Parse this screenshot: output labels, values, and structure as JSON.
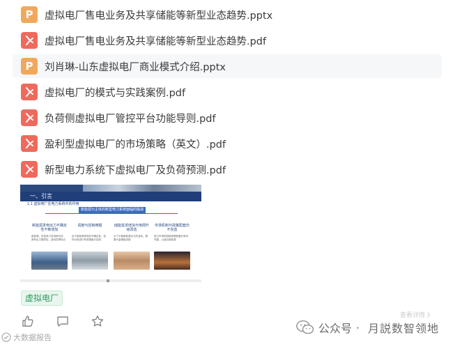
{
  "files": [
    {
      "type": "pptx",
      "icon": "pptx-file-icon",
      "name": "虚拟电厂售电业务及共享储能等新型业态趋势.pptx"
    },
    {
      "type": "pdf",
      "icon": "pdf-file-icon",
      "name": "虚拟电厂售电业务及共享储能等新型业态趋势.pdf"
    },
    {
      "type": "pptx",
      "icon": "pptx-file-icon",
      "name": "刘肖琳-山东虚拟电厂商业模式介绍.pptx"
    },
    {
      "type": "pdf",
      "icon": "pdf-file-icon",
      "name": "虚拟电厂的模式与实践案例.pdf"
    },
    {
      "type": "pdf",
      "icon": "pdf-file-icon",
      "name": "负荷侧虚拟电厂管控平台功能导则.pdf"
    },
    {
      "type": "pdf",
      "icon": "pdf-file-icon",
      "name": "盈利型虚拟电厂的市场策略（英文）.pdf"
    },
    {
      "type": "pdf",
      "icon": "pdf-file-icon",
      "name": "新型电力系统下虚拟电厂及负荷预测.pdf"
    }
  ],
  "pptx_letter": "P",
  "preview": {
    "section": "一、引言",
    "subtitle": "1.1 虚拟电厂在电力系统中的作用",
    "center_box": "新能源为主体的新型电力系统面临的挑战",
    "columns": [
      {
        "head": "新能源发电出力不确定性不断增加",
        "text": "新能源，包括风力发电和光伏，具有出力随机性、波动性等特点"
      },
      {
        "head": "调度与控制难题",
        "text": "由于新能源发电的不确定性，如何对其进行有效调度与控制"
      },
      {
        "head": "储能需求增加与电网升级改造",
        "text": "为了平衡新能源出力的波动，需要大量储能设施"
      },
      {
        "head": "市场机制与政策配套仍不完善",
        "text": "电力市场机制和政策配套仍有待完善，以适应新能源"
      }
    ]
  },
  "tag": "虚拟电厂",
  "actions": [
    "like-icon",
    "comment-icon",
    "favorite-icon"
  ],
  "watermark_left": "大数据报告",
  "watermark_right": {
    "prefix": "公众号",
    "separator": "·",
    "brand": "月説数智领地"
  },
  "faded_text": "查看详情 》",
  "colors": {
    "pptx": "#f0a95c",
    "pdf": "#ee6a5d",
    "tag_text": "#2e9a5c",
    "tag_bg": "#e9f6ef"
  }
}
